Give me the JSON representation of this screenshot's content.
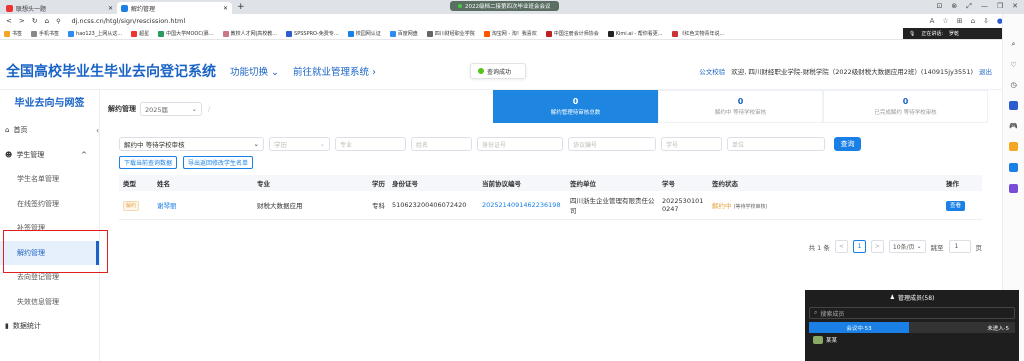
{
  "browser": {
    "tabs": [
      {
        "label": "联想头一题",
        "icon_color": "#e33"
      },
      {
        "label": "解约管理",
        "icon_color": "#1a80e6"
      }
    ],
    "new_tab": "+",
    "share_banner": "2022级档二接第四次毕业班会会议",
    "url": "dj.ncss.cn/htgl/sign/rescission.html",
    "window_controls": [
      "⊡",
      "⊗",
      "⤢",
      "—",
      "❐",
      "✕"
    ],
    "bookmarks": [
      {
        "label": "书签",
        "color": "#f5a623"
      },
      {
        "label": "手机书签",
        "color": "#888"
      },
      {
        "label": "hao123_上网从这...",
        "color": "#2d8cf0"
      },
      {
        "label": "超星",
        "color": "#e33"
      },
      {
        "label": "中国大学MOOC(慕...",
        "color": "#2a9d5c"
      },
      {
        "label": "教校人才网|高校教...",
        "color": "#c78"
      },
      {
        "label": "SPSSPRO-免费专...",
        "color": "#2d5cd0"
      },
      {
        "label": "校园网认证",
        "color": "#1a80e6"
      },
      {
        "label": "百度网盘",
        "color": "#2d8cf0"
      },
      {
        "label": "四川财经职业学院",
        "color": "#666"
      },
      {
        "label": "淘宝网 - 淘！我喜欢",
        "color": "#f50"
      },
      {
        "label": "中国注册会计师协会",
        "color": "#b22"
      },
      {
        "label": "Kimi.ai - 帮你看更...",
        "color": "#222"
      },
      {
        "label": "《红色文物青年说...",
        "color": "#c33"
      }
    ],
    "meeting_bar": {
      "label": "正在讲话:",
      "speaker": "罗乾"
    }
  },
  "header": {
    "system_title": "全国高校毕业生毕业去向登记系统",
    "func_switch": "功能切换",
    "goto_employment": "前往就业管理系统",
    "toast": "查询成功",
    "announcement": "公文校验",
    "welcome": "欢迎, 四川财经职业学院-财税学院（2022级财税大数据应用2班）(140915jy3551)",
    "logout": "退出"
  },
  "sidebar": {
    "title": "毕业去向与网签",
    "items": [
      {
        "label": "首页",
        "type": "top",
        "icon": "home-icon",
        "glyph": "⌂"
      },
      {
        "label": "学生管理",
        "type": "top",
        "icon": "student-icon",
        "glyph": "☻",
        "caret": "^"
      },
      {
        "label": "学生名单管理",
        "type": "sub"
      },
      {
        "label": "在线签约管理",
        "type": "sub"
      },
      {
        "label": "补签管理",
        "type": "sub"
      },
      {
        "label": "解约管理",
        "type": "sub",
        "active": true
      },
      {
        "label": "去向登记管理",
        "type": "sub"
      },
      {
        "label": "失效信息管理",
        "type": "sub"
      },
      {
        "label": "数据统计",
        "type": "top",
        "icon": "chart-icon",
        "glyph": "▮"
      }
    ]
  },
  "main": {
    "section_label": "解约管理",
    "year_value": "2025届",
    "stats": [
      {
        "value": "0",
        "label": "解约管理待审核总数"
      },
      {
        "value": "0",
        "label": "解约中 等待学校审核"
      },
      {
        "value": "0",
        "label": "已完成解约 等待学校审核"
      }
    ],
    "filters": {
      "status_value": "解约中 等待学校审核",
      "education_placeholder": "学历",
      "major_placeholder": "专业",
      "name_placeholder": "姓名",
      "id_placeholder": "身份证号",
      "agreement_placeholder": "协议编号",
      "student_no_placeholder": "学号",
      "unit_placeholder": "单位",
      "query_label": "查询"
    },
    "actions": {
      "download": "下载当前查询数据",
      "import": "导出返回修改学生名单"
    },
    "table": {
      "headers": [
        "类型",
        "姓名",
        "专业",
        "学历",
        "身份证号",
        "当前协议编号",
        "签约单位",
        "学号",
        "签约状态",
        "操作"
      ],
      "rows": [
        {
          "type": "解约",
          "name": "谢琴丽",
          "major": "财税大数据应用",
          "education": "专科",
          "id_no": "510623200406072420",
          "agreement_no": "2025214091462236198",
          "unit": "四川浙生企业管理有限责任公司",
          "student_no": "2022530101 0247",
          "status": "解约中",
          "status_sub": "(等待学校审核)",
          "op": "查看"
        }
      ]
    },
    "pager": {
      "total": "共 1 条",
      "prev": "<",
      "page": "1",
      "next": ">",
      "page_size": "10条/页",
      "goto_label": "跳至",
      "goto_value": "1",
      "page_unit": "页"
    }
  },
  "meeting_panel": {
    "title": "管理成员(58)",
    "search_placeholder": "搜索成员",
    "tab_in": "会议中·53",
    "tab_out": "未进入·5",
    "first_user": "某某"
  }
}
